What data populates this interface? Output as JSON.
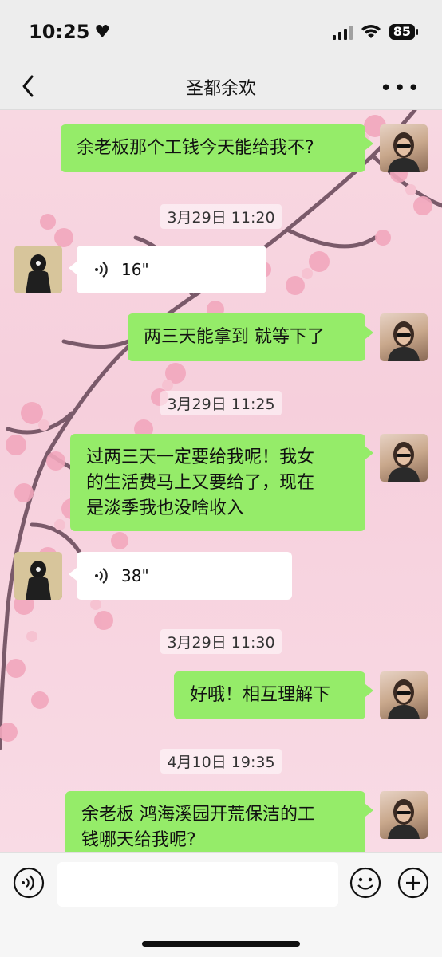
{
  "status": {
    "time": "10:25",
    "battery": "85"
  },
  "header": {
    "title": "圣都余欢"
  },
  "messages": [
    {
      "kind": "text",
      "side": "right",
      "text": "余老板那个工钱今天能给我不?"
    },
    {
      "kind": "time",
      "text": "3月29日 11:20"
    },
    {
      "kind": "voice",
      "side": "left",
      "duration": "16\""
    },
    {
      "kind": "text",
      "side": "right",
      "text": "两三天能拿到 就等下了"
    },
    {
      "kind": "time",
      "text": "3月29日 11:25"
    },
    {
      "kind": "text",
      "side": "right",
      "lines": [
        "过两三天一定要给我呢！我女",
        "的生活费马上又要给了，现在",
        "是淡季我也没啥收入"
      ]
    },
    {
      "kind": "voice",
      "side": "left",
      "duration": "38\""
    },
    {
      "kind": "time",
      "text": "3月29日 11:30"
    },
    {
      "kind": "text",
      "side": "right",
      "text": "好哦！相互理解下"
    },
    {
      "kind": "time",
      "text": "4月10日 19:35"
    },
    {
      "kind": "text",
      "side": "right",
      "lines": [
        "余老板 鸿海溪园开荒保洁的工",
        "钱哪天给我呢?"
      ]
    }
  ],
  "input": {
    "placeholder": ""
  },
  "colors": {
    "bubble_self": "#95ec69",
    "bubble_other": "#ffffff",
    "nav_bg": "#ededed"
  },
  "icons": [
    "back-icon",
    "more-icon",
    "voice-icon",
    "emoji-icon",
    "plus-icon"
  ]
}
